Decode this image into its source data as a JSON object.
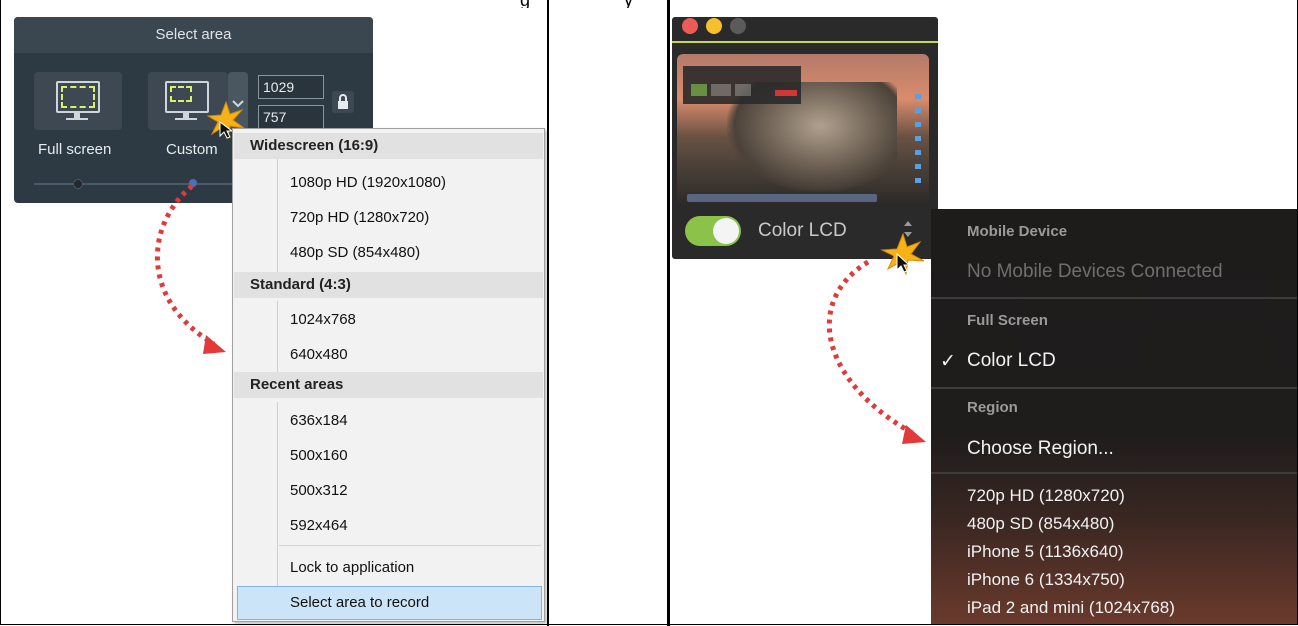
{
  "windows_panel": {
    "header": "Select area",
    "full_screen_label": "Full screen",
    "custom_label": "Custom",
    "width_value": "1029",
    "height_value": "757"
  },
  "windows_menu": {
    "sections": [
      {
        "heading": "Widescreen (16:9)",
        "items": [
          "1080p HD (1920x1080)",
          "720p HD (1280x720)",
          "480p SD (854x480)"
        ]
      },
      {
        "heading": "Standard (4:3)",
        "items": [
          "1024x768",
          "640x480"
        ]
      },
      {
        "heading": "Recent areas",
        "items": [
          "636x184",
          "500x160",
          "500x312",
          "592x464"
        ]
      }
    ],
    "lock_to_application": "Lock to application",
    "select_area_to_record": "Select area to record"
  },
  "mac_panel": {
    "display_label": "Color LCD"
  },
  "mac_menu": {
    "mobile_heading": "Mobile Device",
    "mobile_none": "No Mobile Devices Connected",
    "full_screen_heading": "Full Screen",
    "color_lcd": "Color LCD",
    "check": "✓",
    "region_heading": "Region",
    "choose_region": "Choose Region...",
    "presets": [
      "720p HD (1280x720)",
      "480p SD (854x480)",
      "iPhone 5 (1136x640)",
      "iPhone 6 (1334x750)",
      "iPad 2 and mini (1024x768)"
    ]
  },
  "colors": {
    "arrow": "#e03a3a",
    "toggle_on": "#8bc34a",
    "selection": "#cce4f7"
  }
}
